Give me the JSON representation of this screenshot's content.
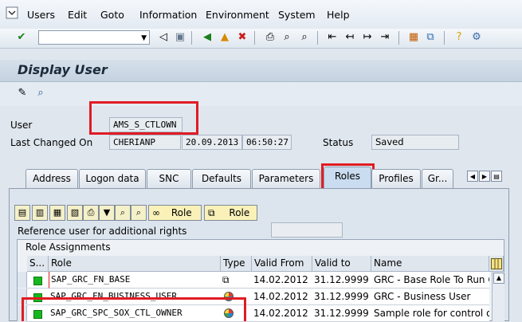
{
  "menu": [
    "Users",
    "Edit",
    "Goto",
    "Information",
    "Environment",
    "System",
    "Help"
  ],
  "toolbar": {
    "icons": [
      "enter-icon",
      "back-icon",
      "save-icon",
      "back-green-icon",
      "exit-icon",
      "cancel-icon",
      "print-icon",
      "find-icon",
      "find-next-icon",
      "first-page-icon",
      "prev-page-icon",
      "next-page-icon",
      "last-page-icon",
      "layout-icon",
      "shortcut-icon",
      "help-icon",
      "settings-icon"
    ]
  },
  "title": "Display User",
  "form": {
    "user_label": "User",
    "user_value": "AMS_S_CTLOWN",
    "last_changed_label": "Last Changed On",
    "changed_by": "CHERIANP",
    "changed_date": "20.09.2013",
    "changed_time": "06:50:27",
    "status_label": "Status",
    "status_value": "Saved"
  },
  "tabs": [
    "Address",
    "Logon data",
    "SNC",
    "Defaults",
    "Parameters",
    "Roles",
    "Profiles",
    "Gr..."
  ],
  "active_tab": "Roles",
  "role_toolbar": {
    "role_btn_1": "Role",
    "role_btn_2": "Role"
  },
  "ref_user_label": "Reference user for additional rights",
  "role_assignments": {
    "title": "Role Assignments",
    "columns": [
      "S...",
      "Role",
      "Type",
      "Valid From",
      "Valid to",
      "Name"
    ],
    "rows": [
      {
        "role": "SAP_GRC_FN_BASE",
        "valid_from": "14.02.2012",
        "valid_to": "31.12.9999",
        "name": "GRC - Base Role To Run GR"
      },
      {
        "role": "SAP_GRC_FN_BUSINESS_USER",
        "valid_from": "14.02.2012",
        "valid_to": "31.12.9999",
        "name": "GRC - Business User"
      },
      {
        "role": "SAP_GRC_SPC_SOX_CTL_OWNER",
        "valid_from": "14.02.2012",
        "valid_to": "31.12.9999",
        "name": "Sample role for control ow"
      }
    ]
  },
  "colors": {
    "highlight": "#e11b22",
    "status_ok": "#18b61e"
  }
}
